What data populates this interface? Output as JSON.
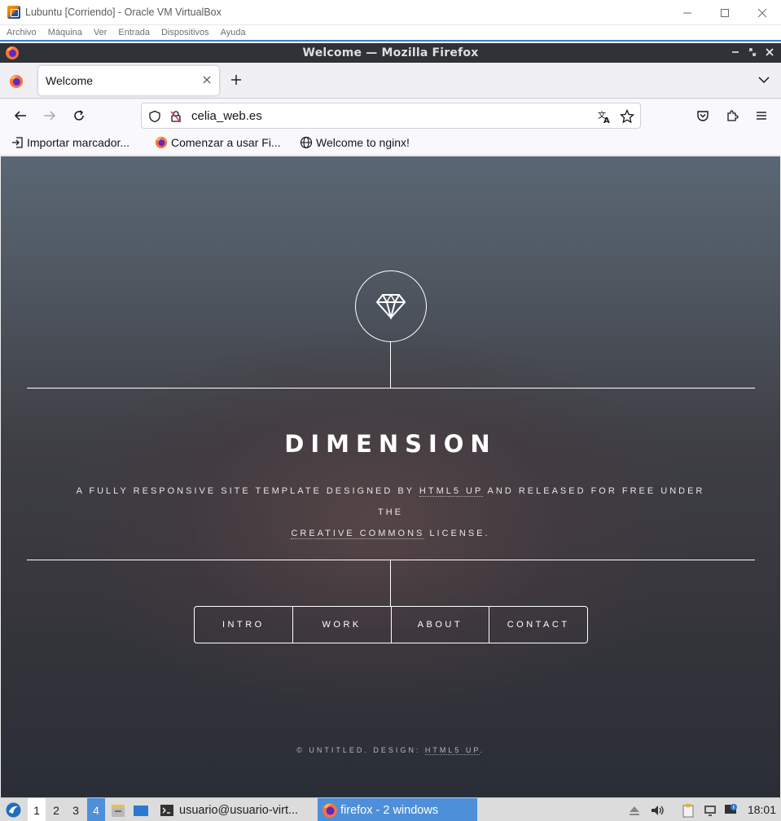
{
  "vbox": {
    "title": "Lubuntu [Corriendo] - Oracle VM VirtualBox",
    "menu": [
      "Archivo",
      "Máquina",
      "Ver",
      "Entrada",
      "Dispositivos",
      "Ayuda"
    ]
  },
  "firefox": {
    "window_title": "Welcome — Mozilla Firefox",
    "tab": {
      "label": "Welcome"
    },
    "url": "celia_web.es",
    "bookmarks": [
      "Importar marcador...",
      "Comenzar a usar Fi...",
      "Welcome to nginx!"
    ]
  },
  "page": {
    "heading": "DIMENSION",
    "subtitle_part1": "A FULLY RESPONSIVE SITE TEMPLATE DESIGNED BY ",
    "subtitle_link1": "HTML5 UP",
    "subtitle_part2": " AND RELEASED FOR FREE UNDER THE ",
    "subtitle_link2": "CREATIVE COMMONS",
    "subtitle_part3": " LICENSE.",
    "menu": [
      "INTRO",
      "WORK",
      "ABOUT",
      "CONTACT"
    ],
    "footer_text": "© UNTITLED. DESIGN: ",
    "footer_link": "HTML5 UP",
    "footer_end": "."
  },
  "taskbar": {
    "workspaces": [
      "1",
      "2",
      "3",
      "4"
    ],
    "tasks": [
      "usuario@usuario-virt...",
      "firefox - 2 windows"
    ],
    "clock": "18:01"
  },
  "colors": {
    "accent": "#4d8fd8",
    "ff_titlebar": "#2f3236",
    "page_top": "#5a6774",
    "page_bottom": "#2a2e37"
  }
}
